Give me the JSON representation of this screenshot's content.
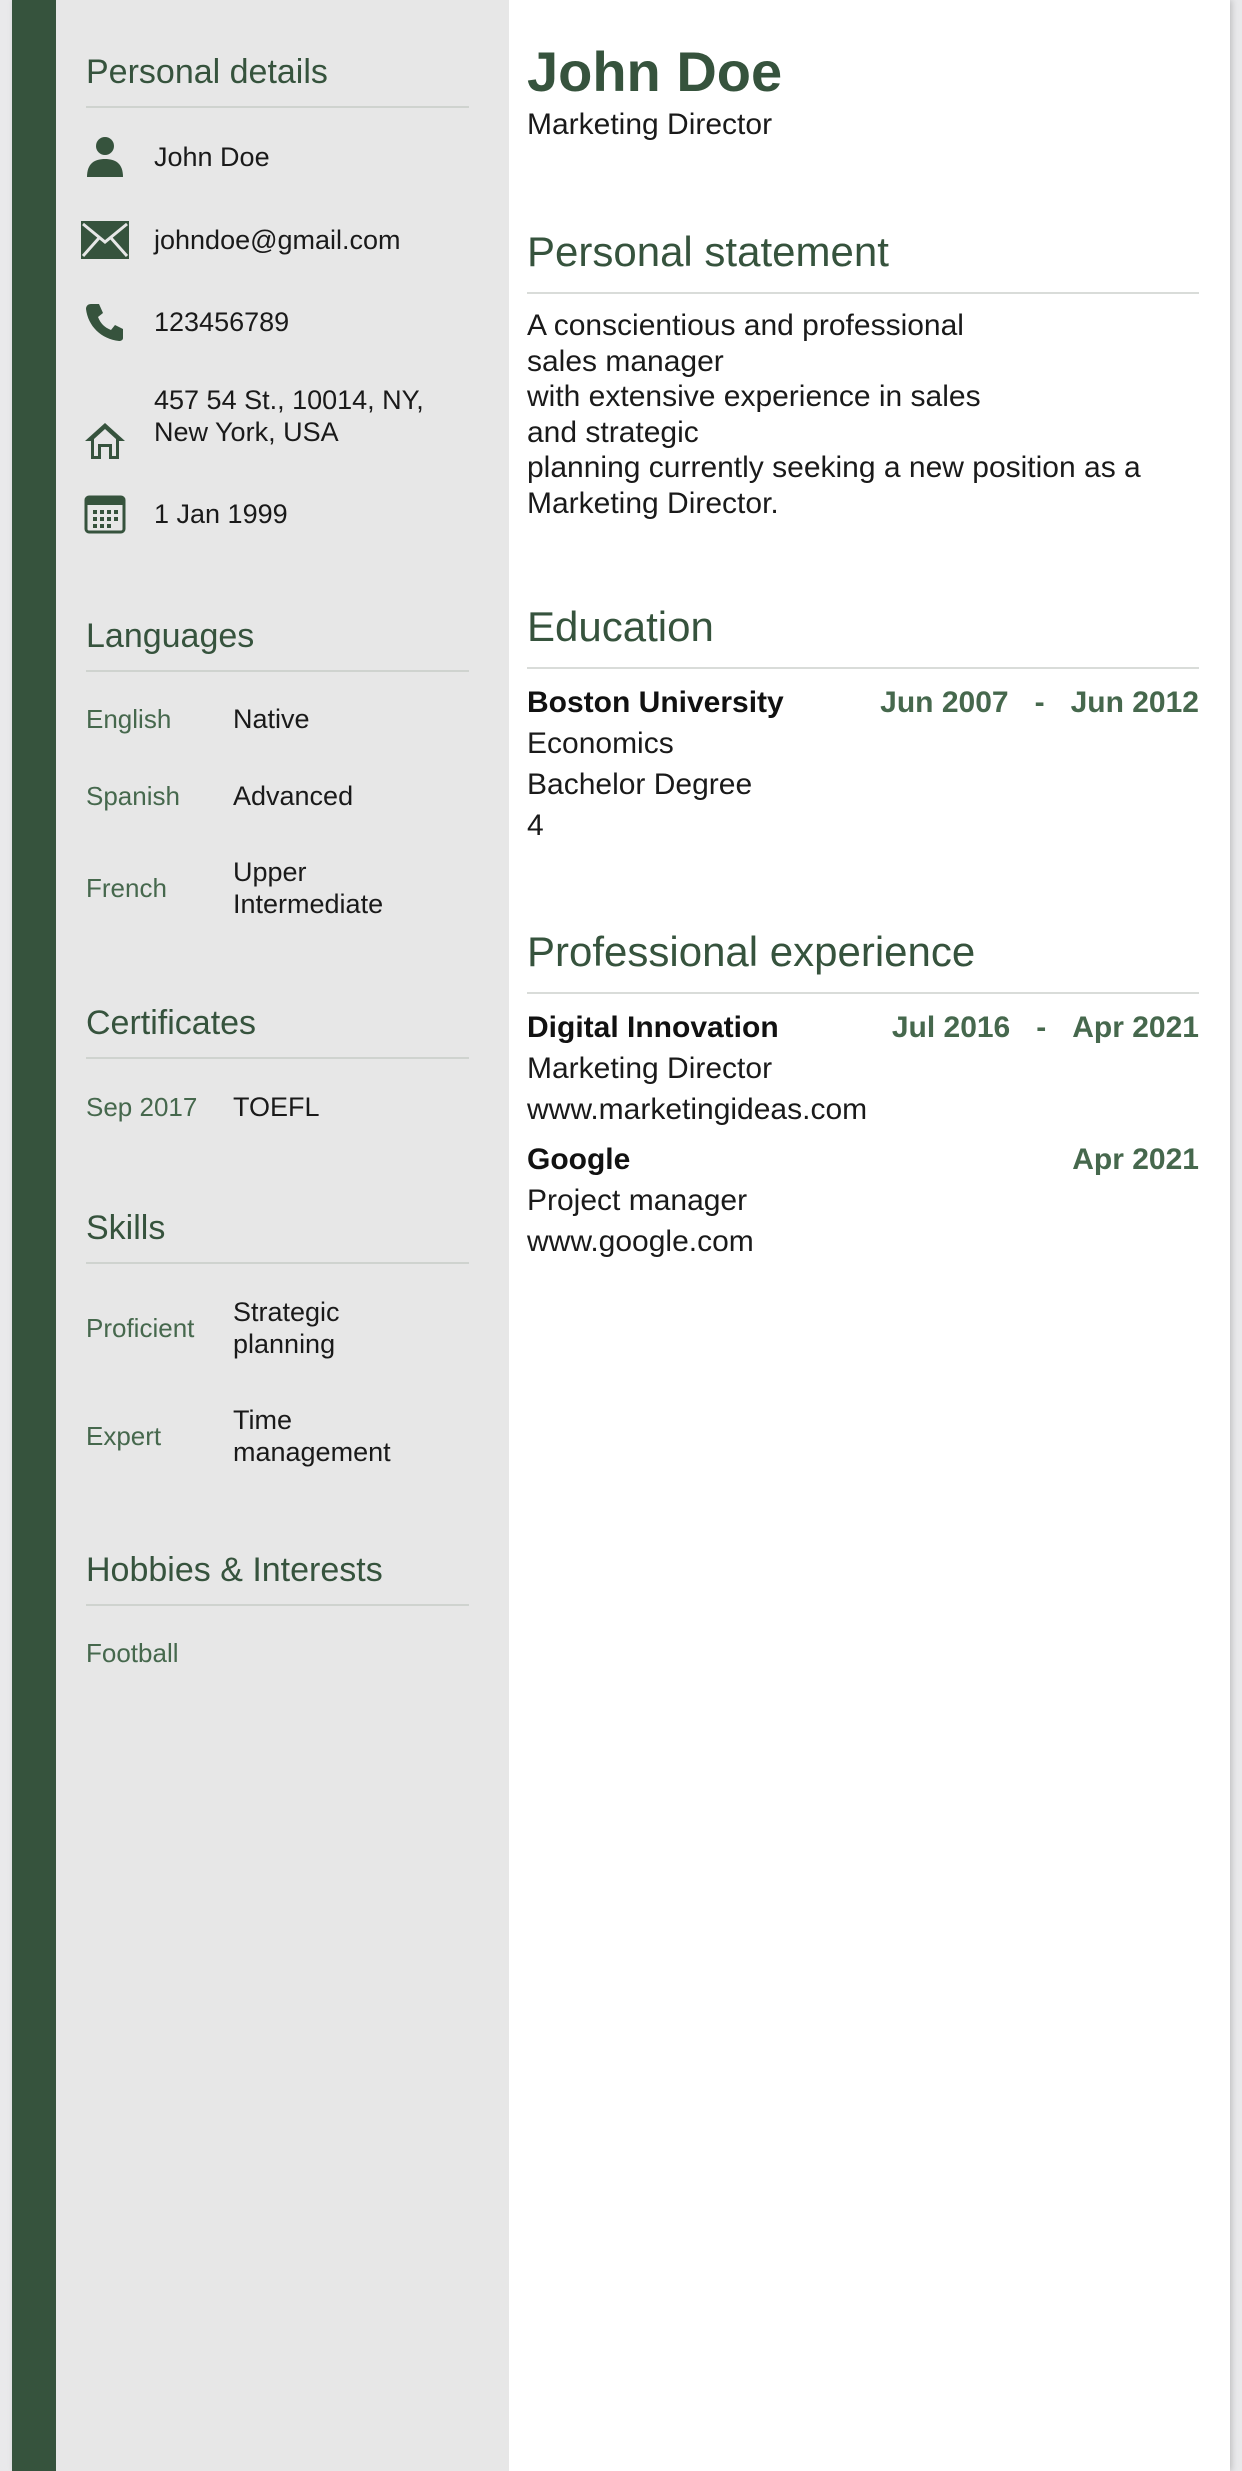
{
  "colors": {
    "accent": "#36533d",
    "accent_light": "#46684d",
    "sidebar_bg": "#e7e7e7",
    "text": "#1a1a1a"
  },
  "sidebar": {
    "personal_details": {
      "title": "Personal details",
      "name": "John Doe",
      "email": "johndoe@gmail.com",
      "phone": "123456789",
      "address_line1": "457 54 St., 10014, NY,",
      "address_line2": "New York, USA",
      "birthdate": "1 Jan 1999",
      "icons": [
        "person-icon",
        "mail-icon",
        "phone-icon",
        "home-icon",
        "calendar-icon"
      ]
    },
    "languages": {
      "title": "Languages",
      "items": [
        {
          "name": "English",
          "level_line1": "Native",
          "level_line2": ""
        },
        {
          "name": "Spanish",
          "level_line1": "Advanced",
          "level_line2": ""
        },
        {
          "name": "French",
          "level_line1": "Upper",
          "level_line2": "Intermediate"
        }
      ]
    },
    "certificates": {
      "title": "Certificates",
      "items": [
        {
          "date": "Sep 2017",
          "name": "TOEFL"
        }
      ]
    },
    "skills": {
      "title": "Skills",
      "items": [
        {
          "level": "Proficient",
          "line1": "Strategic",
          "line2": "planning"
        },
        {
          "level": "Expert",
          "line1": "Time",
          "line2": "management"
        }
      ]
    },
    "hobbies": {
      "title": "Hobbies & Interests",
      "items": [
        "Football"
      ]
    }
  },
  "main": {
    "name": "John Doe",
    "role": "Marketing Director",
    "statement": {
      "title": "Personal statement",
      "lines": [
        "A conscientious and professional",
        "sales manager",
        "with extensive experience in sales",
        "and strategic",
        "planning currently seeking a new position as a",
        "Marketing Director."
      ]
    },
    "education": {
      "title": "Education",
      "entries": [
        {
          "org": "Boston University",
          "start": "Jun 2007",
          "dash": "-",
          "end": "Jun 2012",
          "line1": "Economics",
          "line2": "Bachelor Degree",
          "line3": "4"
        }
      ]
    },
    "experience": {
      "title": "Professional experience",
      "entries": [
        {
          "org": "Digital Innovation",
          "start": "Jul 2016",
          "dash": "-",
          "end": "Apr 2021",
          "line1": "Marketing Director",
          "line2": "www.marketingideas.com"
        },
        {
          "org": "Google",
          "end": "Apr 2021",
          "line1": "Project manager",
          "line2": "www.google.com"
        }
      ]
    }
  }
}
